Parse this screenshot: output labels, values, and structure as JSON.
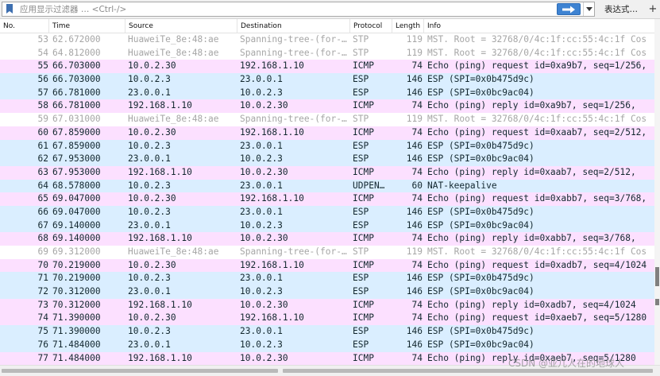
{
  "filter": {
    "placeholder": "应用显示过滤器 … <Ctrl-/>",
    "expression_label": "表达式…",
    "plus_label": "+"
  },
  "columns": [
    "No.",
    "Time",
    "Source",
    "Destination",
    "Protocol",
    "Length",
    "Info"
  ],
  "packets": [
    {
      "no": "53",
      "time": "62.672000",
      "src": "HuaweiTe_8e:48:ae",
      "dst": "Spanning-tree-(for-…",
      "proto": "STP",
      "len": "119",
      "info": "MST. Root = 32768/0/4c:1f:cc:55:4c:1f  Cos",
      "type": "stp"
    },
    {
      "no": "54",
      "time": "64.812000",
      "src": "HuaweiTe_8e:48:ae",
      "dst": "Spanning-tree-(for-…",
      "proto": "STP",
      "len": "119",
      "info": "MST. Root = 32768/0/4c:1f:cc:55:4c:1f  Cos",
      "type": "stp"
    },
    {
      "no": "55",
      "time": "66.703000",
      "src": "10.0.2.30",
      "dst": "192.168.1.10",
      "proto": "ICMP",
      "len": "74",
      "info": "Echo (ping) request  id=0xa9b7, seq=1/256,",
      "type": "icmp"
    },
    {
      "no": "56",
      "time": "66.703000",
      "src": "10.0.2.3",
      "dst": "23.0.0.1",
      "proto": "ESP",
      "len": "146",
      "info": "ESP (SPI=0x0b475d9c)",
      "type": "esp"
    },
    {
      "no": "57",
      "time": "66.781000",
      "src": "23.0.0.1",
      "dst": "10.0.2.3",
      "proto": "ESP",
      "len": "146",
      "info": "ESP (SPI=0x0bc9ac04)",
      "type": "esp"
    },
    {
      "no": "58",
      "time": "66.781000",
      "src": "192.168.1.10",
      "dst": "10.0.2.30",
      "proto": "ICMP",
      "len": "74",
      "info": "Echo (ping) reply    id=0xa9b7, seq=1/256,",
      "type": "icmp"
    },
    {
      "no": "59",
      "time": "67.031000",
      "src": "HuaweiTe_8e:48:ae",
      "dst": "Spanning-tree-(for-…",
      "proto": "STP",
      "len": "119",
      "info": "MST. Root = 32768/0/4c:1f:cc:55:4c:1f  Cos",
      "type": "stp"
    },
    {
      "no": "60",
      "time": "67.859000",
      "src": "10.0.2.30",
      "dst": "192.168.1.10",
      "proto": "ICMP",
      "len": "74",
      "info": "Echo (ping) request  id=0xaab7, seq=2/512,",
      "type": "icmp"
    },
    {
      "no": "61",
      "time": "67.859000",
      "src": "10.0.2.3",
      "dst": "23.0.0.1",
      "proto": "ESP",
      "len": "146",
      "info": "ESP (SPI=0x0b475d9c)",
      "type": "esp"
    },
    {
      "no": "62",
      "time": "67.953000",
      "src": "23.0.0.1",
      "dst": "10.0.2.3",
      "proto": "ESP",
      "len": "146",
      "info": "ESP (SPI=0x0bc9ac04)",
      "type": "esp"
    },
    {
      "no": "63",
      "time": "67.953000",
      "src": "192.168.1.10",
      "dst": "10.0.2.30",
      "proto": "ICMP",
      "len": "74",
      "info": "Echo (ping) reply    id=0xaab7, seq=2/512,",
      "type": "icmp"
    },
    {
      "no": "64",
      "time": "68.578000",
      "src": "10.0.2.3",
      "dst": "23.0.0.1",
      "proto": "UDPEN…",
      "len": "60",
      "info": "NAT-keepalive",
      "type": "udp"
    },
    {
      "no": "65",
      "time": "69.047000",
      "src": "10.0.2.30",
      "dst": "192.168.1.10",
      "proto": "ICMP",
      "len": "74",
      "info": "Echo (ping) request  id=0xabb7, seq=3/768,",
      "type": "icmp"
    },
    {
      "no": "66",
      "time": "69.047000",
      "src": "10.0.2.3",
      "dst": "23.0.0.1",
      "proto": "ESP",
      "len": "146",
      "info": "ESP (SPI=0x0b475d9c)",
      "type": "esp"
    },
    {
      "no": "67",
      "time": "69.140000",
      "src": "23.0.0.1",
      "dst": "10.0.2.3",
      "proto": "ESP",
      "len": "146",
      "info": "ESP (SPI=0x0bc9ac04)",
      "type": "esp"
    },
    {
      "no": "68",
      "time": "69.140000",
      "src": "192.168.1.10",
      "dst": "10.0.2.30",
      "proto": "ICMP",
      "len": "74",
      "info": "Echo (ping) reply    id=0xabb7, seq=3/768,",
      "type": "icmp"
    },
    {
      "no": "69",
      "time": "69.312000",
      "src": "HuaweiTe_8e:48:ae",
      "dst": "Spanning-tree-(for-…",
      "proto": "STP",
      "len": "119",
      "info": "MST. Root = 32768/0/4c:1f:cc:55:4c:1f  Cos",
      "type": "stp"
    },
    {
      "no": "70",
      "time": "70.219000",
      "src": "10.0.2.30",
      "dst": "192.168.1.10",
      "proto": "ICMP",
      "len": "74",
      "info": "Echo (ping) request  id=0xadb7, seq=4/1024",
      "type": "icmp"
    },
    {
      "no": "71",
      "time": "70.219000",
      "src": "10.0.2.3",
      "dst": "23.0.0.1",
      "proto": "ESP",
      "len": "146",
      "info": "ESP (SPI=0x0b475d9c)",
      "type": "esp"
    },
    {
      "no": "72",
      "time": "70.312000",
      "src": "23.0.0.1",
      "dst": "10.0.2.3",
      "proto": "ESP",
      "len": "146",
      "info": "ESP (SPI=0x0bc9ac04)",
      "type": "esp"
    },
    {
      "no": "73",
      "time": "70.312000",
      "src": "192.168.1.10",
      "dst": "10.0.2.30",
      "proto": "ICMP",
      "len": "74",
      "info": "Echo (ping) reply    id=0xadb7, seq=4/1024",
      "type": "icmp"
    },
    {
      "no": "74",
      "time": "71.390000",
      "src": "10.0.2.30",
      "dst": "192.168.1.10",
      "proto": "ICMP",
      "len": "74",
      "info": "Echo (ping) request  id=0xaeb7, seq=5/1280",
      "type": "icmp"
    },
    {
      "no": "75",
      "time": "71.390000",
      "src": "10.0.2.3",
      "dst": "23.0.0.1",
      "proto": "ESP",
      "len": "146",
      "info": "ESP (SPI=0x0b475d9c)",
      "type": "esp"
    },
    {
      "no": "76",
      "time": "71.484000",
      "src": "23.0.0.1",
      "dst": "10.0.2.3",
      "proto": "ESP",
      "len": "146",
      "info": "ESP (SPI=0x0bc9ac04)",
      "type": "esp"
    },
    {
      "no": "77",
      "time": "71.484000",
      "src": "192.168.1.10",
      "dst": "10.0.2.30",
      "proto": "ICMP",
      "len": "74",
      "info": "Echo (ping) reply    id=0xaeb7, seq=5/1280",
      "type": "icmp"
    }
  ],
  "watermark": "CSDN @亚儿人在的地球人",
  "colors": {
    "icmp_row": "#fce0ff",
    "esp_row": "#daeeff",
    "stp_text": "#a6a6a6",
    "apply_button": "#3e83d2"
  },
  "icons": {
    "bookmark": "bookmark-icon",
    "apply": "arrow-right-icon",
    "dropdown": "chevron-down-icon"
  }
}
